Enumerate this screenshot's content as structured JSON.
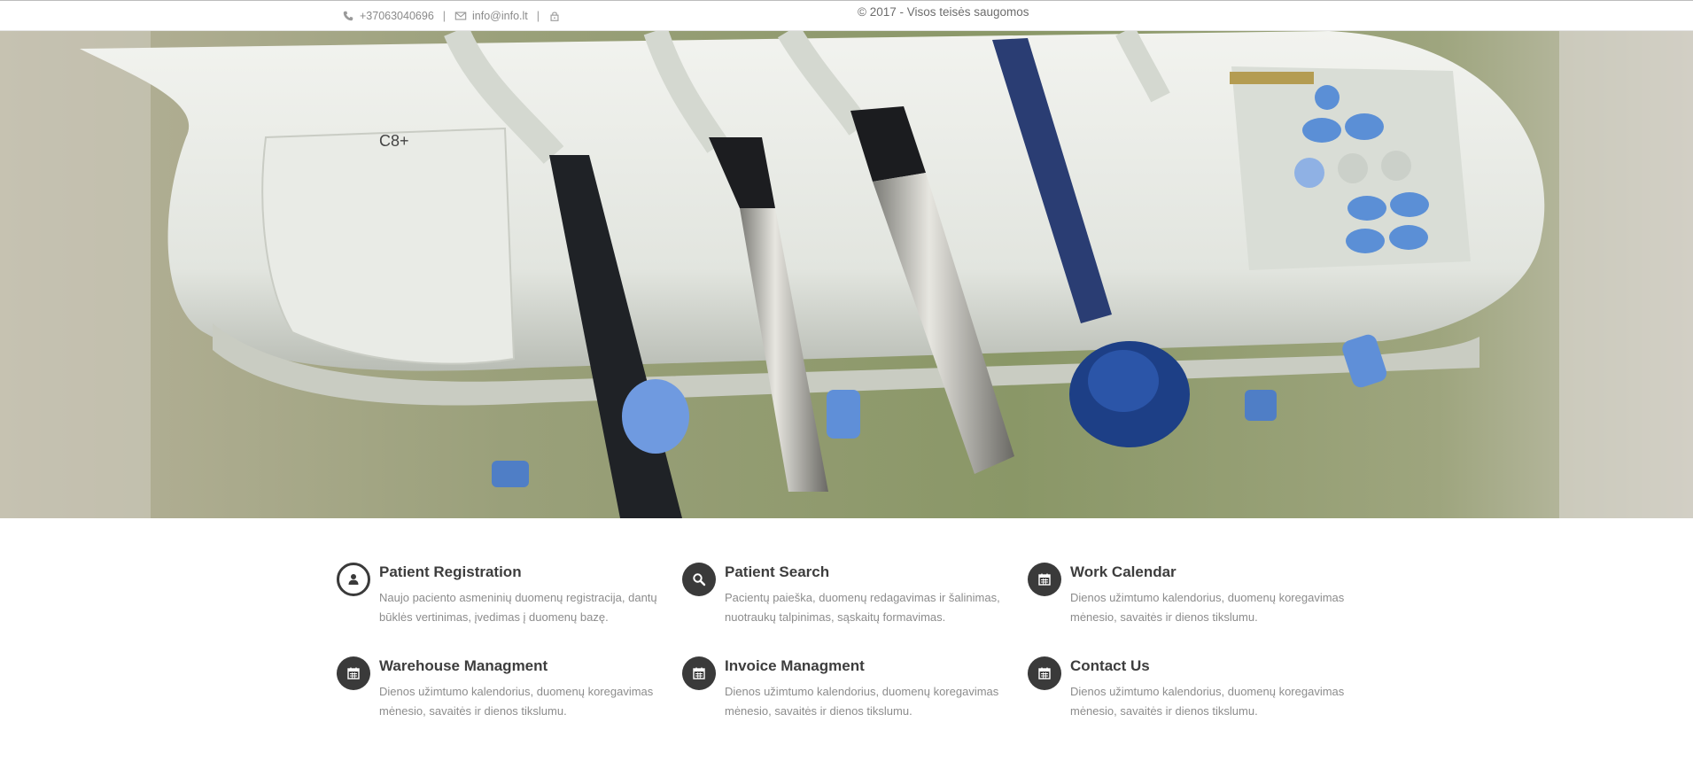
{
  "topbar": {
    "phone": "+37063040696",
    "email": "info@info.lt",
    "separator": "|",
    "copyright": "© 2017 - Visos teisės saugomos",
    "icons": [
      "phone-icon",
      "envelope-icon",
      "lock-icon"
    ]
  },
  "hero": {
    "image": "dental-instruments-photo",
    "panel_label": "C8+"
  },
  "features": [
    {
      "title": "Patient Registration",
      "description": "Naujo paciento asmeninių duomenų registracija, dantų būklės vertinimas, įvedimas į duomenų bazę.",
      "icon": "user-icon"
    },
    {
      "title": "Patient Search",
      "description": "Pacientų paieška, duomenų redagavimas ir šalinimas, nuotraukų talpinimas, sąskaitų formavimas.",
      "icon": "search-icon"
    },
    {
      "title": "Work Calendar",
      "description": "Dienos užimtumo kalendorius, duomenų koregavimas mėnesio, savaitės ir dienos tikslumu.",
      "icon": "calendar-icon"
    },
    {
      "title": "Warehouse Managment",
      "description": "Dienos užimtumo kalendorius, duomenų koregavimas mėnesio, savaitės ir dienos tikslumu.",
      "icon": "calendar-icon"
    },
    {
      "title": "Invoice Managment",
      "description": "Dienos užimtumo kalendorius, duomenų koregavimas mėnesio, savaitės ir dienos tikslumu.",
      "icon": "calendar-icon"
    },
    {
      "title": "Contact Us",
      "description": "Dienos užimtumo kalendorius, duomenų koregavimas mėnesio, savaitės ir dienos tikslumu.",
      "icon": "calendar-icon"
    }
  ],
  "colors": {
    "icon_circle": "#3a3a3a",
    "title_text": "#3d3d3d",
    "body_text": "#8c8c8c",
    "accent_blue": "#5b8fd6"
  }
}
